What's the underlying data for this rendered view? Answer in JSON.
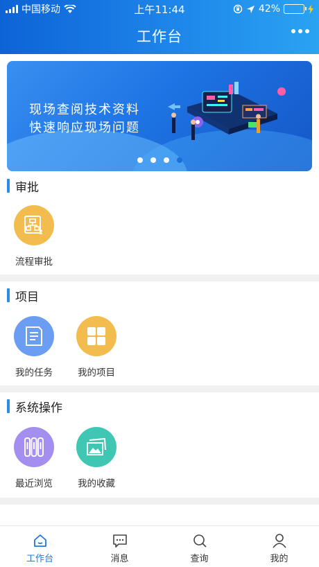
{
  "status_bar": {
    "carrier": "中国移动",
    "time": "上午11:44",
    "battery_percent": "42%",
    "battery_level": 0.42
  },
  "header": {
    "title": "工作台",
    "more_icon": "ellipsis-icon"
  },
  "banner": {
    "line1": "现场查阅技术资料",
    "line2": "快速响应现场问题",
    "slide_count": 4,
    "active_slide": 4
  },
  "sections": [
    {
      "title": "审批",
      "items": [
        {
          "label": "流程审批",
          "icon": "flowchart-icon",
          "color": "#f2bd4e"
        }
      ]
    },
    {
      "title": "项目",
      "items": [
        {
          "label": "我的任务",
          "icon": "document-icon",
          "color": "#6b9df2"
        },
        {
          "label": "我的项目",
          "icon": "grid-icon",
          "color": "#f2bd4e"
        }
      ]
    },
    {
      "title": "系统操作",
      "items": [
        {
          "label": "最近浏览",
          "icon": "books-icon",
          "color": "#a48ef0"
        },
        {
          "label": "我的收藏",
          "icon": "picture-icon",
          "color": "#3fc7b4"
        }
      ]
    }
  ],
  "tabbar": {
    "tabs": [
      {
        "label": "工作台",
        "icon": "home-icon",
        "active": true
      },
      {
        "label": "消息",
        "icon": "message-icon",
        "active": false
      },
      {
        "label": "查询",
        "icon": "search-icon",
        "active": false
      },
      {
        "label": "我的",
        "icon": "user-icon",
        "active": false
      }
    ],
    "active_color": "#1a78e0"
  }
}
